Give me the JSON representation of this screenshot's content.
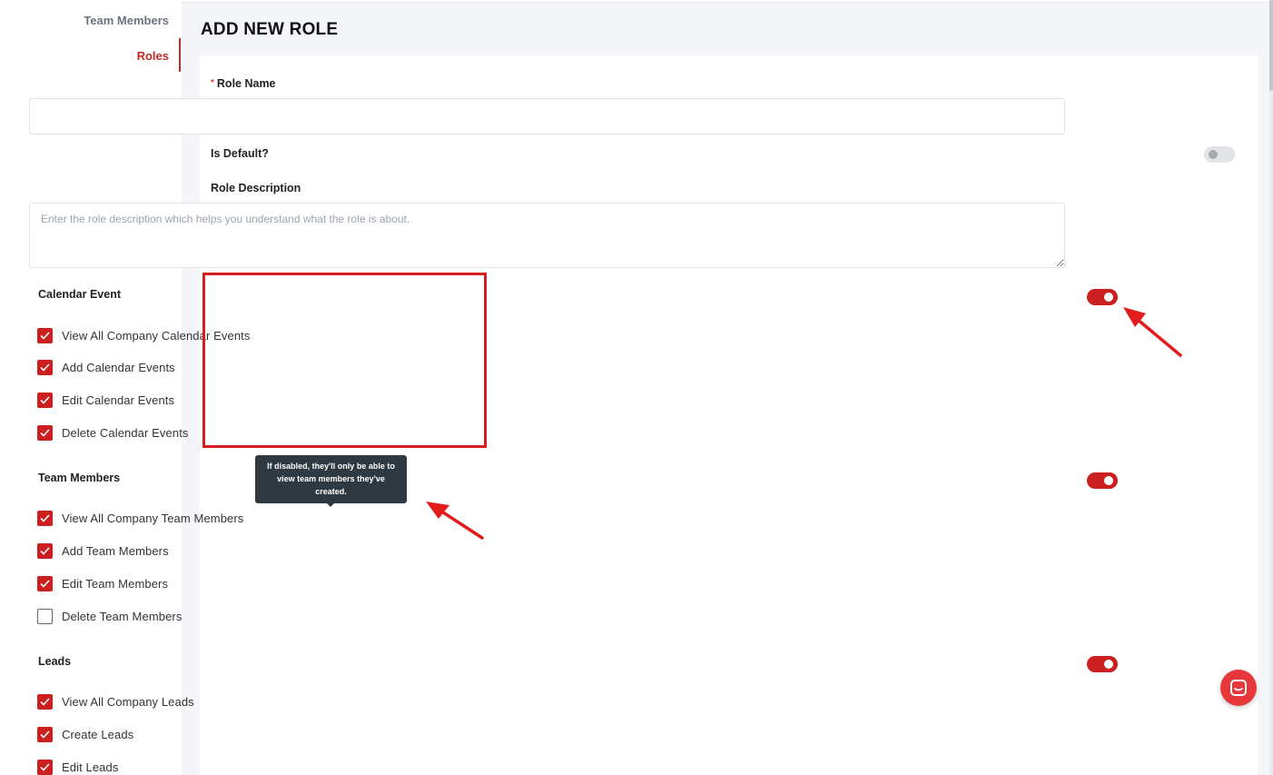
{
  "sidebar": {
    "items": [
      {
        "label": "Team Members"
      },
      {
        "label": "Roles"
      }
    ]
  },
  "page": {
    "title": "ADD NEW ROLE"
  },
  "form": {
    "role_name": {
      "required_mark": "*",
      "label": "Role Name",
      "value": ""
    },
    "is_default": {
      "label": "Is Default?",
      "enabled": false
    },
    "role_description": {
      "label": "Role Description",
      "placeholder": "Enter the role description which helps you understand what the role is about.",
      "value": ""
    }
  },
  "permissions": {
    "calendar": {
      "title": "Calendar Event",
      "enabled": true,
      "items": [
        {
          "label": "View All Company Calendar Events",
          "checked": true
        },
        {
          "label": "Add Calendar Events",
          "checked": true
        },
        {
          "label": "Edit Calendar Events",
          "checked": true
        },
        {
          "label": "Delete Calendar Events",
          "checked": true
        }
      ]
    },
    "team": {
      "title": "Team Members",
      "enabled": true,
      "items": [
        {
          "label": "View All Company Team Members",
          "checked": true
        },
        {
          "label": "Add Team Members",
          "checked": true
        },
        {
          "label": "Edit Team Members",
          "checked": true
        },
        {
          "label": "Delete Team Members",
          "checked": false
        }
      ]
    },
    "leads": {
      "title": "Leads",
      "enabled": true,
      "items": [
        {
          "label": "View All Company Leads",
          "checked": true
        },
        {
          "label": "Create Leads",
          "checked": true
        },
        {
          "label": "Edit Leads",
          "checked": true
        }
      ]
    }
  },
  "tooltip": {
    "text": "If disabled, they'll only be able to view team members they've created."
  },
  "colors": {
    "accent": "#cc1f1f",
    "annotation": "#d71e1e",
    "chat": "#e8373a"
  },
  "icons": {
    "checkbox": "checkmark-icon",
    "chat": "chat-icon",
    "annotation": "arrow-icon"
  }
}
